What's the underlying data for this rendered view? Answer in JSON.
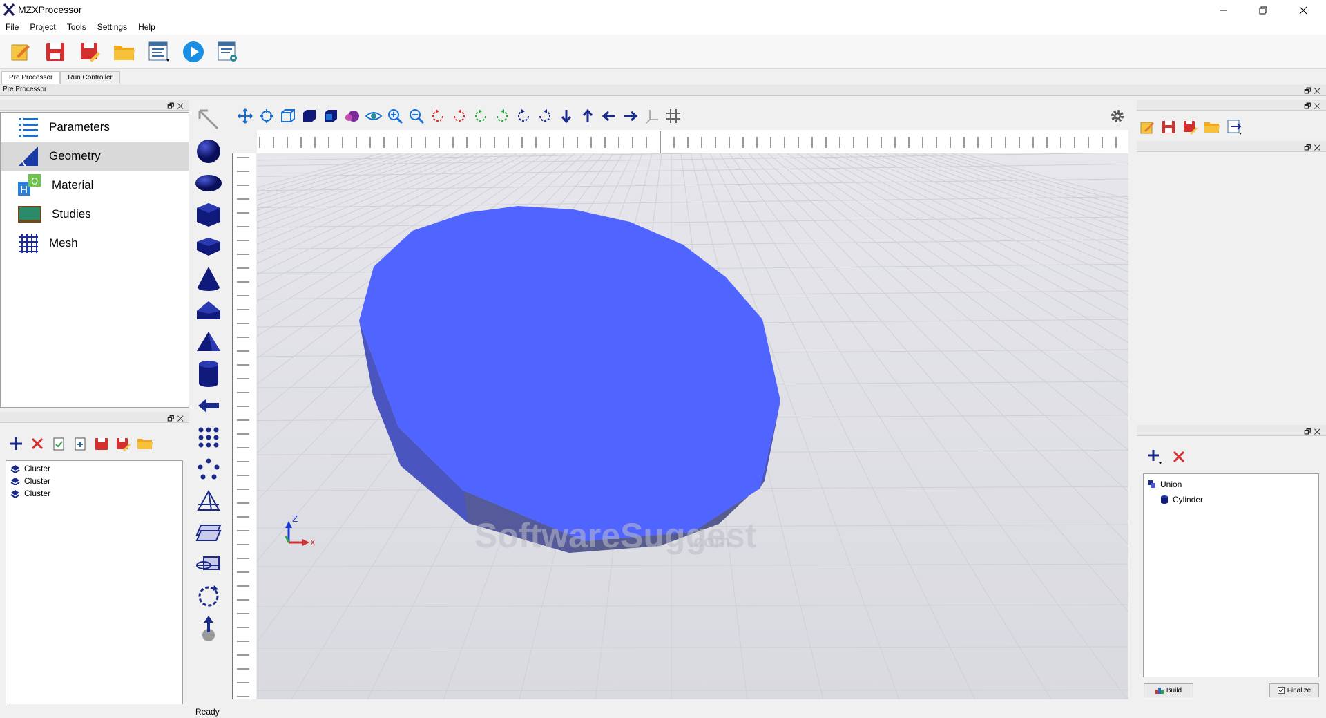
{
  "window": {
    "title": "MZXProcessor"
  },
  "menu": [
    "File",
    "Project",
    "Tools",
    "Settings",
    "Help"
  ],
  "tabs": {
    "pre_processor": "Pre Processor",
    "run_controller": "Run Controller"
  },
  "dock_title": "Pre Processor",
  "nav": {
    "items": [
      {
        "label": "Parameters",
        "icon": "list-icon"
      },
      {
        "label": "Geometry",
        "icon": "geometry-icon",
        "selected": true
      },
      {
        "label": "Material",
        "icon": "material-icon"
      },
      {
        "label": "Studies",
        "icon": "studies-icon"
      },
      {
        "label": "Mesh",
        "icon": "mesh-icon"
      }
    ]
  },
  "clusters": [
    "Cluster",
    "Cluster",
    "Cluster"
  ],
  "tree": {
    "root": "Union",
    "child": "Cylinder"
  },
  "buttons": {
    "build": "Build",
    "finalize": "Finalize"
  },
  "status": "Ready",
  "watermark": {
    "main": "SoftwareSuggest",
    "suffix": ".com"
  },
  "axes": {
    "z": "Z",
    "x": "X"
  },
  "colors": {
    "shape_top": "#5064ff",
    "shape_side": "#4a55c8",
    "accent_blue": "#0078d7"
  }
}
